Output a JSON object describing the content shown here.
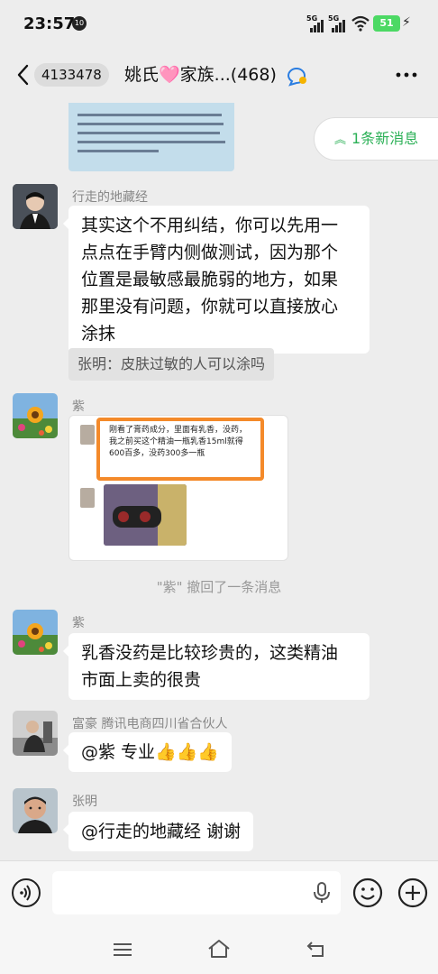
{
  "status_bar": {
    "time": "23:57",
    "notif_badge": "10",
    "signal1_label": "5G",
    "signal2_label": "5G",
    "battery": "51"
  },
  "header": {
    "back_count": "4133478",
    "title": "姚氏🩷家族...(468)"
  },
  "new_messages_label": "1条新消息",
  "top_image_text": "乳香+没药，是止痛良药，身体上一切痛症，不管是头痛心痛，还是胃痛肚子痛，或者是腰痛腿痛，脚痛关节痛等等，乳香+没药都可以治。",
  "messages": [
    {
      "sender": "行走的地藏经",
      "text_lines": [
        "其实这个不用纠结，你可以先用一",
        "点点在手臂内侧做测试，因为那个",
        "位置是最敏感最脆弱的地方，如果",
        "那里没有问题，你就可以直接放心",
        "涂抹"
      ],
      "quote": "张明：皮肤过敏的人可以涂吗"
    },
    {
      "sender": "紫",
      "screenshot_text": "刚看了膏药成分，里面有乳香，没药，我之前买这个精油一瓶乳香15ml就得600百多，没药300多一瓶"
    },
    {
      "recall": "\"紫\" 撤回了一条消息"
    },
    {
      "sender": "紫",
      "text_lines": [
        "乳香没药是比较珍贵的，这类精油",
        "市面上卖的很贵"
      ]
    },
    {
      "sender": "富豪 腾讯电商四川省合伙人",
      "text": "@紫  专业👍👍👍"
    },
    {
      "sender": "张明",
      "text": "@行走的地藏经  谢谢"
    }
  ],
  "input": {
    "placeholder": ""
  },
  "colors": {
    "accent_green": "#2bb056",
    "chat_bg": "#ededed",
    "highlight_orange": "#f48a2a"
  }
}
